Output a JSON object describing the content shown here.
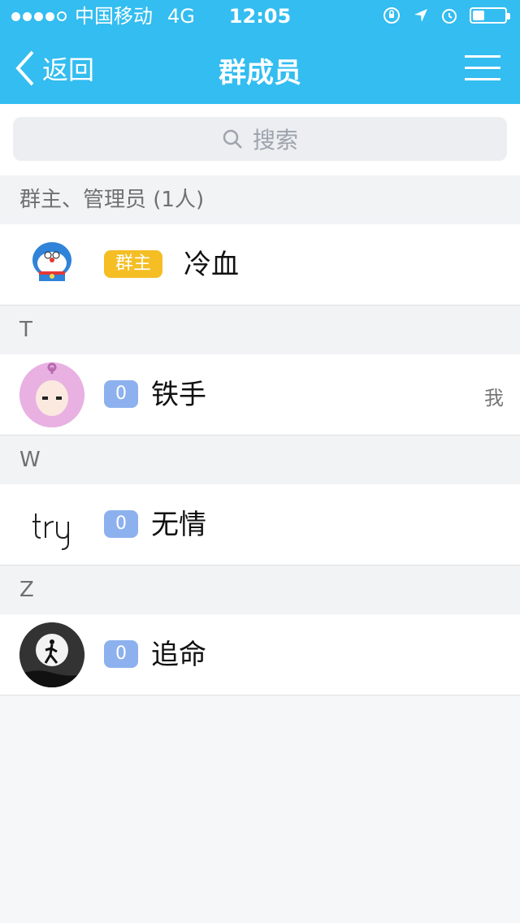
{
  "status_bar": {
    "carrier": "中国移动",
    "network": "4G",
    "time": "12:05"
  },
  "nav": {
    "back_label": "返回",
    "title": "群成员"
  },
  "search": {
    "placeholder": "搜索"
  },
  "sections": [
    {
      "header": "群主、管理员 (1人)",
      "members": [
        {
          "name": "冷血",
          "badge": "群主"
        }
      ]
    },
    {
      "header": "T",
      "members": [
        {
          "name": "铁手",
          "badge": "0",
          "me_label": "我"
        }
      ]
    },
    {
      "header": "W",
      "members": [
        {
          "name": "无情",
          "badge": "0"
        }
      ]
    },
    {
      "header": "Z",
      "members": [
        {
          "name": "追命",
          "badge": "0"
        }
      ]
    }
  ],
  "colors": {
    "primary": "#33bdf0",
    "owner_badge": "#f4be24",
    "level_badge": "#8db1ee"
  }
}
